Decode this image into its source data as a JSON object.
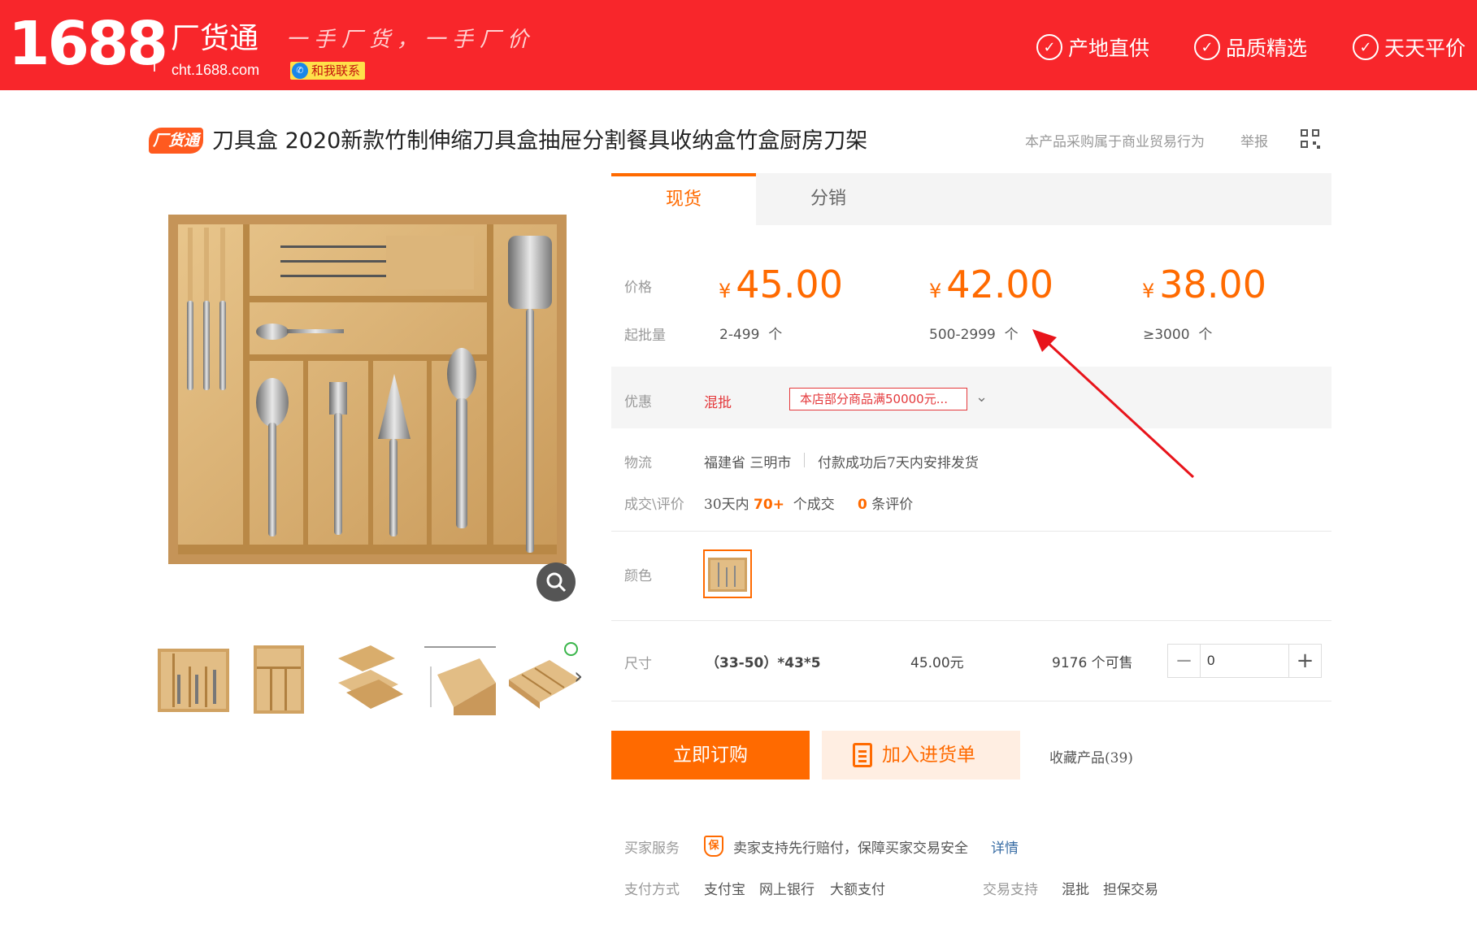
{
  "header": {
    "logo": "1688",
    "brand_name": "厂货通",
    "brand_url": "cht.1688.com",
    "slogan": "一手厂货，一手厂价",
    "contact_label": "和我联系",
    "promises": [
      "产地直供",
      "品质精选",
      "天天平价"
    ]
  },
  "product": {
    "badge": "厂货通",
    "title": "刀具盒 2020新款竹制伸缩刀具盒抽屉分割餐具收纳盒竹盒厨房刀架",
    "notice": "本产品采购属于商业贸易行为",
    "report": "举报"
  },
  "tabs": [
    "现货",
    "分销"
  ],
  "pricing": {
    "price_label": "价格",
    "moq_label": "起批量",
    "currency": "¥",
    "tiers": [
      {
        "price": "45.00",
        "range": "2-499",
        "unit": "个"
      },
      {
        "price": "42.00",
        "range": "500-2999",
        "unit": "个"
      },
      {
        "price": "38.00",
        "range": "≥3000",
        "unit": "个"
      }
    ]
  },
  "promo": {
    "label": "优惠",
    "tag": "混批",
    "offer": "本店部分商品满50000元..."
  },
  "logistics": {
    "label": "物流",
    "origin": "福建省 三明市",
    "shipping": "付款成功后7天内安排发货"
  },
  "deals": {
    "label": "成交\\评价",
    "prefix": "30天内",
    "count": "70+",
    "suffix": "个成交",
    "reviews": "0",
    "reviews_suffix": "条评价"
  },
  "color": {
    "label": "颜色"
  },
  "size": {
    "label": "尺寸",
    "spec": "（33-50）*43*5",
    "price": "45.00元",
    "stock": "9176 个可售",
    "qty": "0"
  },
  "actions": {
    "buy": "立即订购",
    "add_cart": "加入进货单",
    "favorite": "收藏产品(39)"
  },
  "service": {
    "label": "买家服务",
    "badge": "保",
    "text": "卖家支持先行赔付，保障买家交易安全",
    "detail": "详情"
  },
  "payment": {
    "label": "支付方式",
    "methods": [
      "支付宝",
      "网上银行",
      "大额支付"
    ],
    "trade_label": "交易支持",
    "trade_items": [
      "混批",
      "担保交易"
    ]
  },
  "colors": {
    "header_red": "#f8262b",
    "accent_orange": "#ff6a00",
    "promo_red": "#e4393c",
    "annotation_red": "#e8141b"
  }
}
